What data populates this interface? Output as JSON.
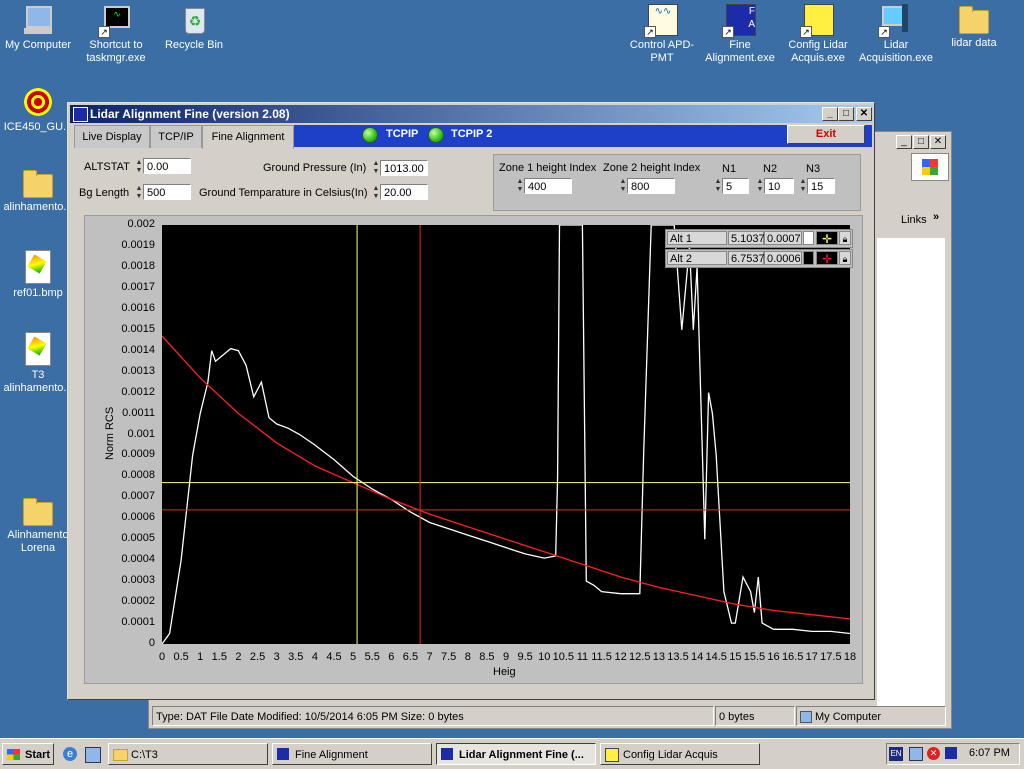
{
  "desktop": {
    "icons": [
      {
        "label": "My Computer"
      },
      {
        "label": "Shortcut to taskmgr.exe"
      },
      {
        "label": "Recycle Bin"
      },
      {
        "label": "ICE450_GU..."
      },
      {
        "label": "alinhamento..."
      },
      {
        "label": "ref01.bmp"
      },
      {
        "label": "T3 alinhamento..."
      },
      {
        "label": "Alinhamento Lorena"
      },
      {
        "label": "Control APD-PMT"
      },
      {
        "label": "Fine Alignment.exe"
      },
      {
        "label": "Config Lidar Acquis.exe"
      },
      {
        "label": "Lidar Acquisition.exe"
      },
      {
        "label": "lidar data"
      }
    ]
  },
  "bg_window": {
    "links_label": "Links",
    "status_text": "Type: DAT File Date Modified: 10/5/2014 6:05 PM Size: 0 bytes",
    "status_size": "0 bytes",
    "status_location": "My Computer"
  },
  "app": {
    "title": "Lidar Alignment Fine (version 2.08)",
    "tabs": [
      "Live Display",
      "TCP/IP",
      "Fine Alignment"
    ],
    "led1_label": "TCPIP",
    "led2_label": "TCPIP 2",
    "exit_label": "Exit",
    "fields": {
      "altstat_label": "ALTSTAT",
      "altstat_value": "0.00",
      "bglength_label": "Bg Length",
      "bglength_value": "500",
      "pressure_label": "Ground Pressure (In)",
      "pressure_value": "1013.00",
      "temp_label": "Ground Temparature in Celsius(In)",
      "temp_value": "20.00",
      "zone1_label": "Zone 1 height Index",
      "zone1_value": "400",
      "zone2_label": "Zone 2 height Index",
      "zone2_value": "800",
      "n1_label": "N1",
      "n1_value": "5",
      "n2_label": "N2",
      "n2_value": "10",
      "n3_label": "N3",
      "n3_value": "15"
    },
    "cursors": [
      {
        "name": "Alt 1",
        "x": "5.1037",
        "y": "0.0007",
        "color": "#ffff80"
      },
      {
        "name": "Alt 2",
        "x": "6.7537",
        "y": "0.0006",
        "color": "#ff2020"
      }
    ]
  },
  "chart_data": {
    "type": "line",
    "xlabel": "Heig",
    "ylabel": "Norm RCS",
    "xlim": [
      0,
      18
    ],
    "ylim": [
      0,
      0.002
    ],
    "x_ticks": [
      "0",
      "0.5",
      "1",
      "1.5",
      "2",
      "2.5",
      "3",
      "3.5",
      "4",
      "4.5",
      "5",
      "5.5",
      "6",
      "6.5",
      "7",
      "7.5",
      "8",
      "8.5",
      "9",
      "9.5",
      "10",
      "10.5",
      "11",
      "11.5",
      "12",
      "12.5",
      "13",
      "13.5",
      "14",
      "14.5",
      "15",
      "15.5",
      "16",
      "16.5",
      "17",
      "17.5",
      "18"
    ],
    "y_ticks": [
      "0",
      "0.0001",
      "0.0002",
      "0.0003",
      "0.0004",
      "0.0005",
      "0.0006",
      "0.0007",
      "0.0008",
      "0.0009",
      "0.001",
      "0.0011",
      "0.0012",
      "0.0013",
      "0.0014",
      "0.0015",
      "0.0016",
      "0.0017",
      "0.0018",
      "0.0019",
      "0.002"
    ],
    "cursor_lines": [
      {
        "x": 5.1037,
        "y": 0.00077,
        "color": "#ffff80"
      },
      {
        "x": 6.7537,
        "y": 0.00064,
        "color": "#ff2020"
      }
    ],
    "series": [
      {
        "color": "#ffffff",
        "x": [
          0,
          0.2,
          0.5,
          0.8,
          1.0,
          1.2,
          1.3,
          1.4,
          1.6,
          1.8,
          2.0,
          2.2,
          2.4,
          2.6,
          2.8,
          3.0,
          3.3,
          3.6,
          4.0,
          4.5,
          5.0,
          5.5,
          6.0,
          6.5,
          7.0,
          7.5,
          8.0,
          8.5,
          9.0,
          9.5,
          10.0,
          10.3,
          10.35,
          10.4,
          10.5,
          10.6,
          10.8,
          11.0,
          11.1,
          11.3,
          11.5,
          12.0,
          12.5,
          12.6,
          12.8,
          13.0,
          13.1,
          13.4,
          13.6,
          13.8,
          13.9,
          14.0,
          14.2,
          14.3,
          14.4,
          14.5,
          14.7,
          14.9,
          15.0,
          15.2,
          15.4,
          15.5,
          15.6,
          15.7,
          15.9,
          16.0,
          16.5,
          17.0,
          17.5,
          18.0
        ],
        "y": [
          0,
          5e-05,
          0.0004,
          0.0009,
          0.0011,
          0.00125,
          0.0014,
          0.00135,
          0.00138,
          0.00141,
          0.0014,
          0.00133,
          0.00118,
          0.00125,
          0.00108,
          0.00105,
          0.00103,
          0.001,
          0.00095,
          0.00088,
          0.0008,
          0.00074,
          0.00069,
          0.00063,
          0.00058,
          0.00055,
          0.00052,
          0.00049,
          0.00046,
          0.00043,
          0.00041,
          0.00042,
          0.0008,
          0.002,
          0.002,
          0.002,
          0.002,
          0.002,
          0.0003,
          0.00028,
          0.00025,
          0.00024,
          0.00024,
          0.0009,
          0.002,
          0.002,
          0.002,
          0.002,
          0.0015,
          0.0019,
          0.0015,
          0.0018,
          0.0005,
          0.0012,
          0.0011,
          0.0009,
          0.00025,
          0.0001,
          0.0001,
          0.00032,
          0.00025,
          0.00015,
          0.00032,
          0.0001,
          8e-05,
          7e-05,
          7e-05,
          6e-05,
          6e-05,
          5e-05
        ]
      },
      {
        "color": "#ff2020",
        "x": [
          0,
          1,
          2,
          3,
          4,
          5,
          6,
          7,
          8,
          9,
          10,
          11,
          12,
          13,
          14,
          15,
          16,
          17,
          18
        ],
        "y": [
          0.00147,
          0.00127,
          0.0011,
          0.00096,
          0.00085,
          0.00077,
          0.00069,
          0.00062,
          0.00056,
          0.0005,
          0.00044,
          0.00038,
          0.00032,
          0.00027,
          0.00023,
          0.00019,
          0.00016,
          0.00014,
          0.00012
        ]
      }
    ]
  },
  "taskbar": {
    "start_label": "Start",
    "buttons": [
      "C:\\T3",
      "Fine Alignment",
      "Lidar Alignment Fine (...",
      "Config Lidar Acquis"
    ],
    "clock": "6:07 PM",
    "lang": "EN"
  }
}
